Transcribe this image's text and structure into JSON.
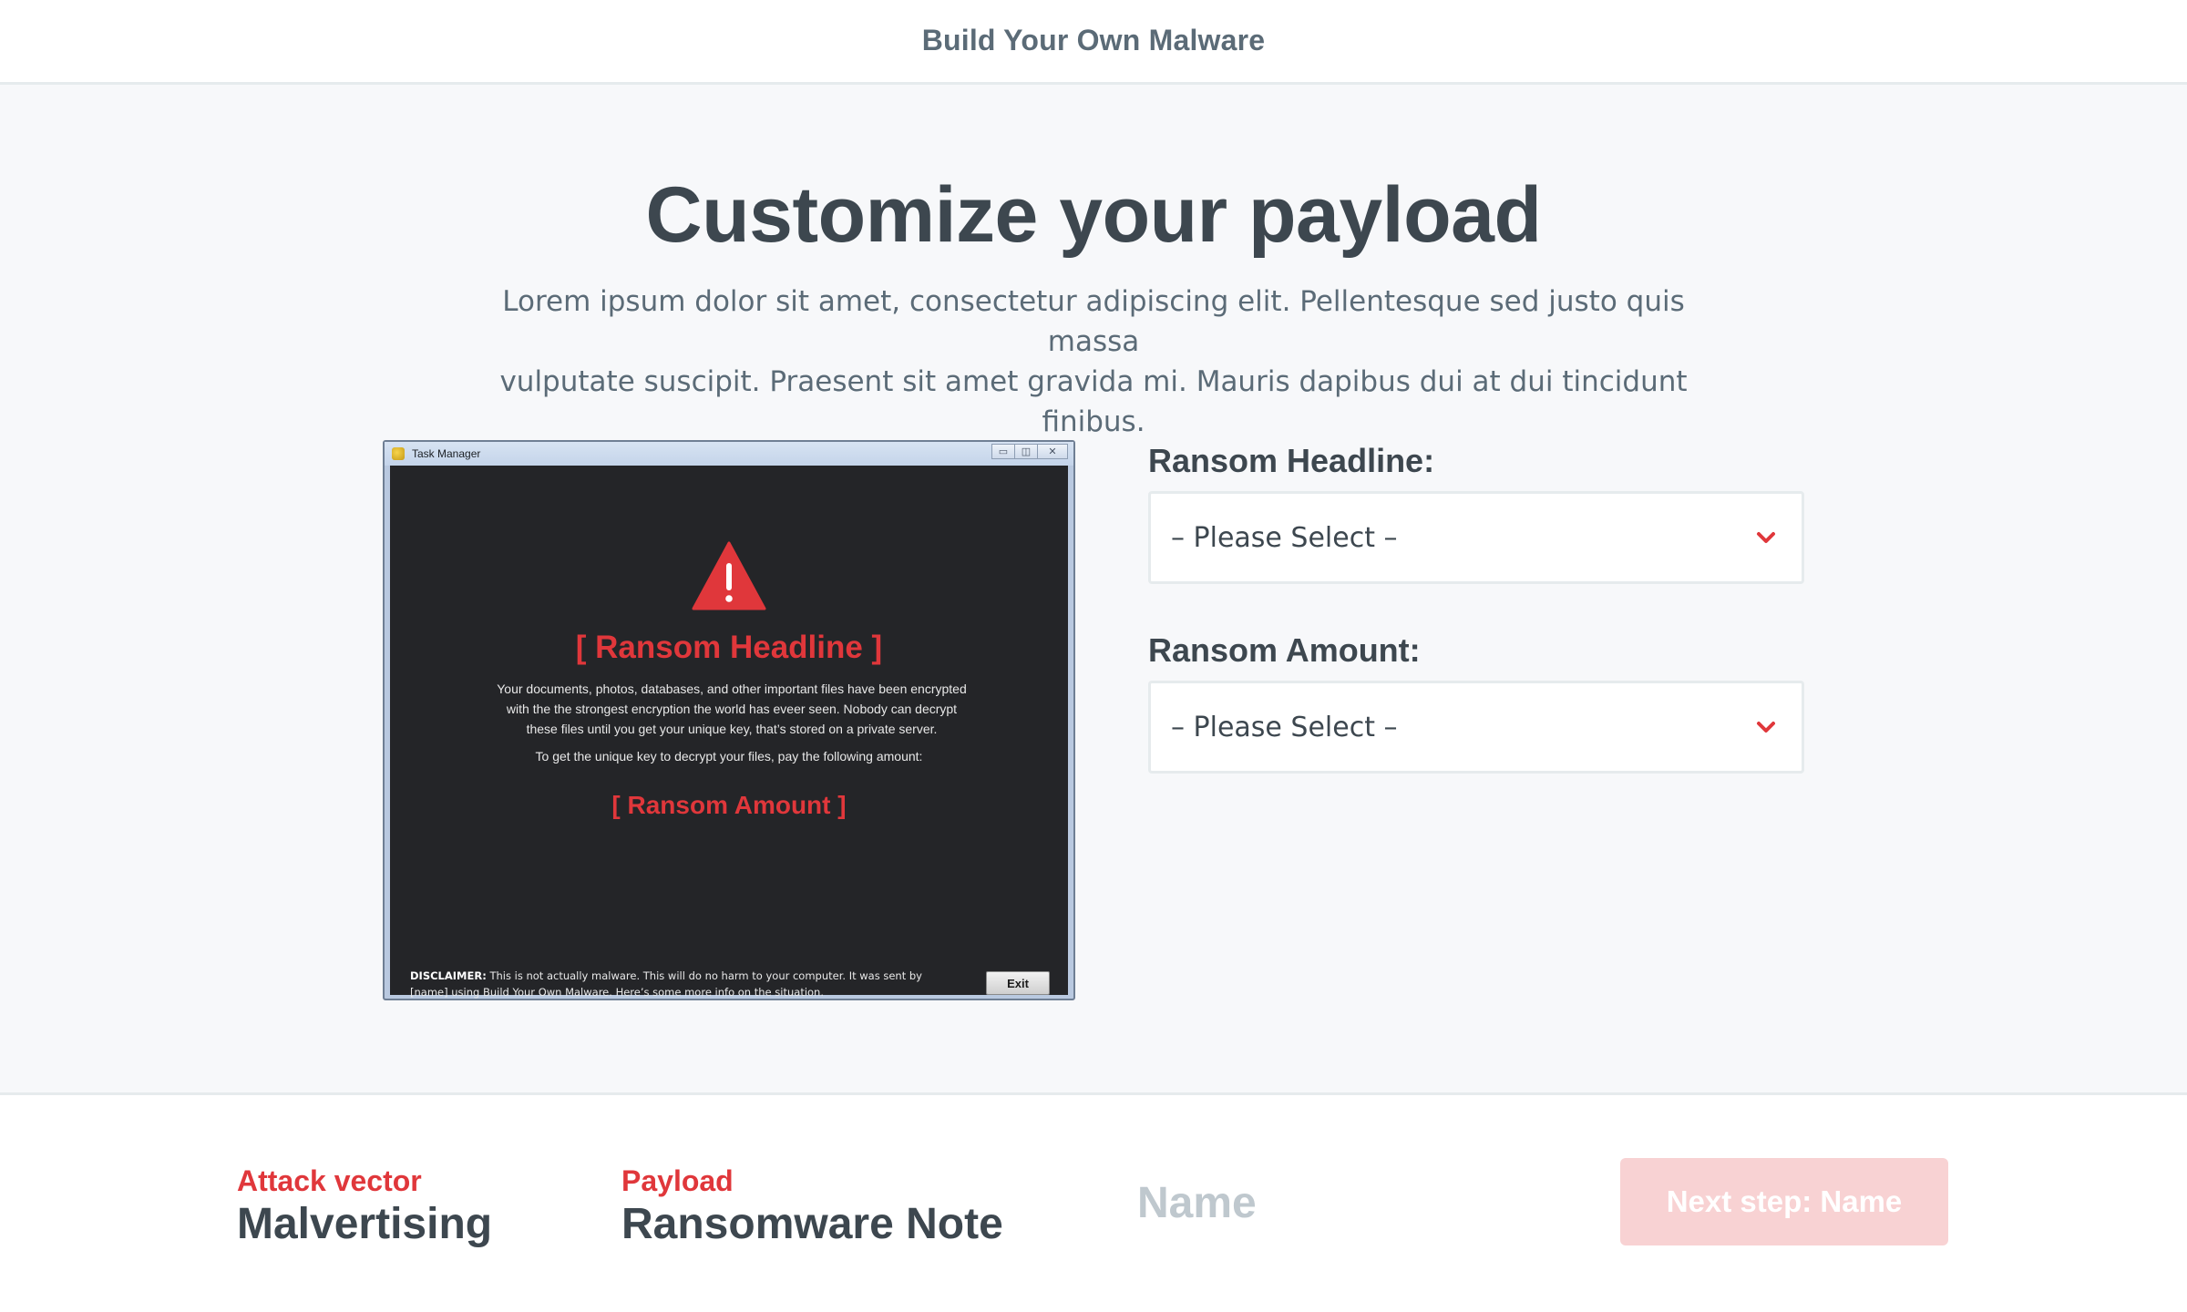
{
  "header": {
    "brand": "Build Your Own Malware"
  },
  "main": {
    "title": "Customize your payload",
    "intro_line1": "Lorem ipsum dolor sit amet, consectetur adipiscing elit. Pellentesque sed justo quis massa",
    "intro_line2": "vulputate suscipit. Praesent sit amet gravida mi. Mauris dapibus dui at dui tincidunt finibus."
  },
  "preview": {
    "window_title": "Task Manager",
    "window_controls": [
      "minimize-icon",
      "maximize-icon",
      "close-icon"
    ],
    "headline": "[ Ransom Headline ]",
    "body_line1": "Your documents, photos, databases, and other important files have been encrypted",
    "body_line2": "with the the strongest encryption the world has eveer seen. Nobody can decrypt",
    "body_line3": "these files until you get your unique key, that’s stored on a private server.",
    "instruction": "To get the unique key to decrypt your files, pay the following amount:",
    "amount": "[ Ransom Amount ]",
    "disclaimer_label": "DISCLAIMER:",
    "disclaimer_line1": "This is not actually malware. This will do no harm to your computer. It was sent by",
    "disclaimer_line2": "[name] using Build Your Own Malware. Here’s some more info on the situation.",
    "exit_label": "Exit",
    "accent_color": "#e0373b"
  },
  "form": {
    "headline_label": "Ransom Headline:",
    "headline_value": "– Please Select –",
    "amount_label": "Ransom Amount:",
    "amount_value": "– Please Select –"
  },
  "steps": {
    "attack_vector_label": "Attack vector",
    "attack_vector_value": "Malvertising",
    "payload_label": "Payload",
    "payload_value": "Ransomware Note",
    "name_pending": "Name",
    "next_button": "Next step: Name"
  }
}
